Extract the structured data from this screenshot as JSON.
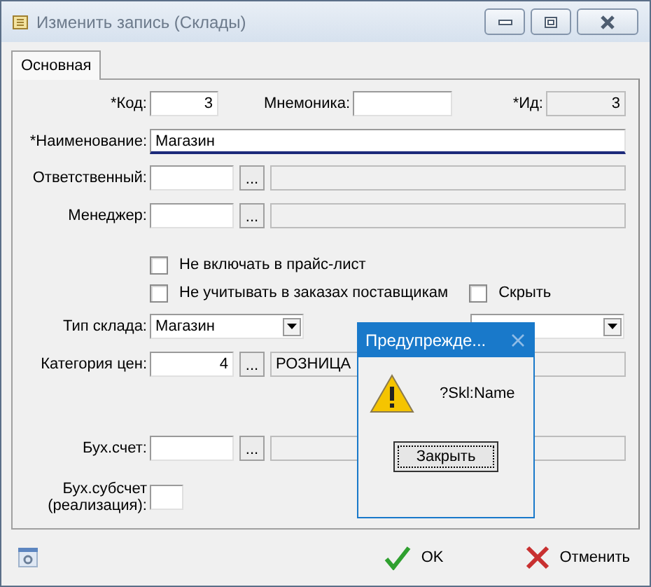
{
  "window": {
    "title": "Изменить запись (Склады)"
  },
  "tabs": [
    {
      "label": "Основная",
      "selected": true
    }
  ],
  "code": {
    "label": "*Код:",
    "value": "3"
  },
  "mnemonic": {
    "label": "Мнемоника:"
  },
  "id": {
    "label": "*Ид:",
    "value": "3"
  },
  "name": {
    "label": "*Наименование:",
    "value": "Магазин"
  },
  "lookups": [
    {
      "label": "Ответственный:",
      "button": "..."
    },
    {
      "label": "Менеджер:",
      "button": "..."
    }
  ],
  "checkboxes": [
    {
      "label": "Не включать в прайс-лист",
      "checked": false
    },
    {
      "label": "Не учитывать в заказах поставщикам",
      "checked": false
    },
    {
      "label": "Скрыть",
      "checked": false
    }
  ],
  "warehouse_type": {
    "label": "Тип склада:",
    "value": "Магазин"
  },
  "price_category": {
    "label": "Категория цен:",
    "code": "4",
    "button": "...",
    "name": "РОЗНИЦА"
  },
  "account": {
    "label": "Бух.счет:",
    "button": "..."
  },
  "subaccount": {
    "label": "Бух.субсчет\n(реализация):"
  },
  "buttons": [
    {
      "label": "OK",
      "kind": "ok"
    },
    {
      "label": "Отменить",
      "kind": "cancel"
    }
  ],
  "alert": {
    "title": "Предупрежде...",
    "message": "?Skl:Name",
    "button": "Закрыть"
  }
}
